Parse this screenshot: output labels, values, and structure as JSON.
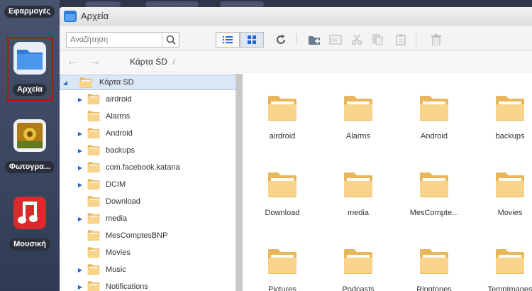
{
  "dock": {
    "apps_label": "Εφαρμογές",
    "apps": [
      {
        "label": "Αρχεία",
        "icon": "folder-icon"
      },
      {
        "label": "Φωτογρα...",
        "icon": "photos-icon"
      },
      {
        "label": "Μουσική",
        "icon": "music-icon"
      }
    ]
  },
  "window": {
    "title": "Αρχεία",
    "search_placeholder": "Αναζήτηση",
    "breadcrumb": "Κάρτα SD",
    "breadcrumb_sep": "/",
    "back_glyph": "←",
    "forward_glyph": "→"
  },
  "tree": {
    "root": "Κάρτα SD",
    "items": [
      {
        "name": "airdroid",
        "expandable": true
      },
      {
        "name": "Alarms",
        "expandable": false
      },
      {
        "name": "Android",
        "expandable": true
      },
      {
        "name": "backups",
        "expandable": true
      },
      {
        "name": "com.facebook.katana",
        "expandable": true
      },
      {
        "name": "DCIM",
        "expandable": true
      },
      {
        "name": "Download",
        "expandable": false
      },
      {
        "name": "media",
        "expandable": true
      },
      {
        "name": "MesComptesBNP",
        "expandable": false
      },
      {
        "name": "Movies",
        "expandable": false
      },
      {
        "name": "Music",
        "expandable": true
      },
      {
        "name": "Notifications",
        "expandable": true
      }
    ]
  },
  "grid": {
    "items": [
      "airdroid",
      "Alarms",
      "Android",
      "backups",
      "Download",
      "media",
      "MesCompte...",
      "Movies",
      "Pictures",
      "Podcasts",
      "Ringtones",
      "TempImages"
    ]
  },
  "colors": {
    "accent": "#2266cc",
    "highlight_box": "#e00000",
    "folder": "#f5c878"
  }
}
